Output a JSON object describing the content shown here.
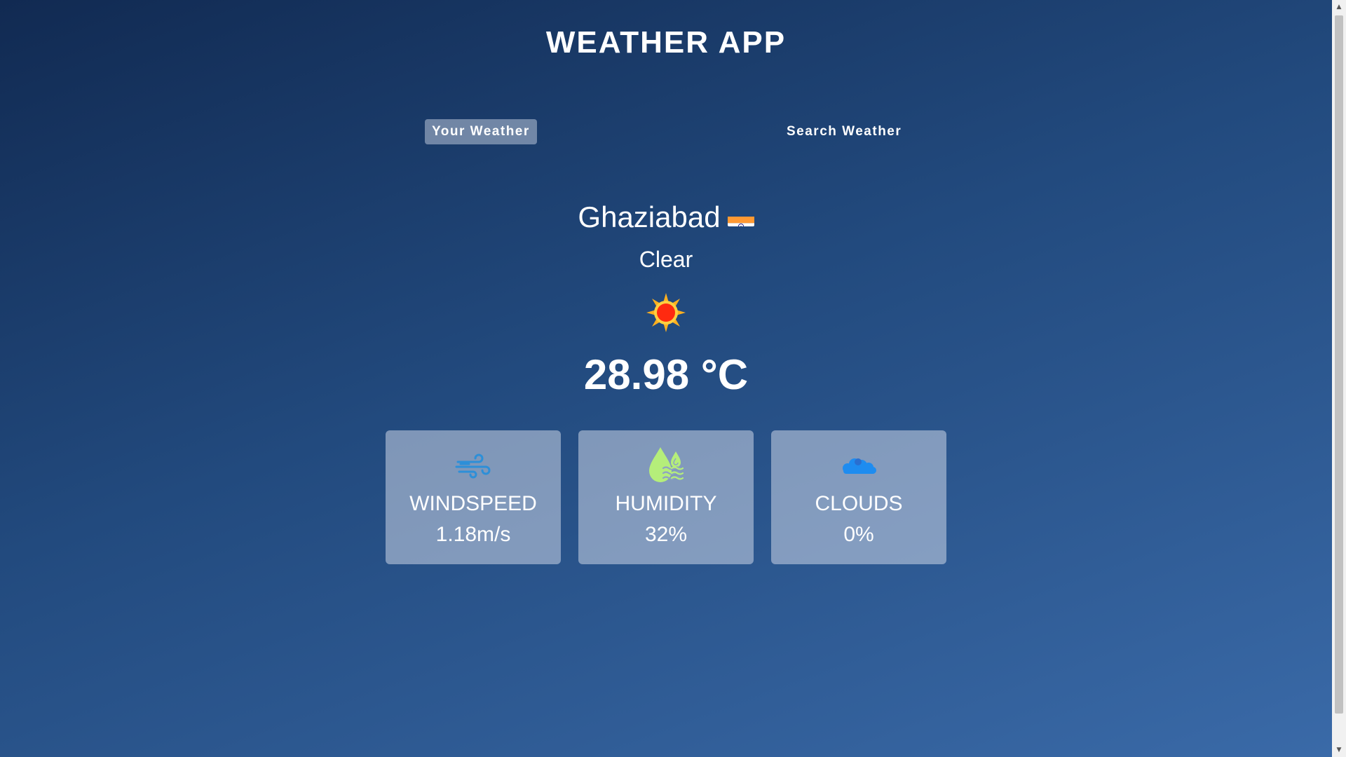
{
  "app": {
    "title": "WEATHER APP"
  },
  "tabs": [
    {
      "label": "Your Weather",
      "active": true
    },
    {
      "label": "Search Weather",
      "active": false
    }
  ],
  "weather": {
    "city": "Ghaziabad",
    "country_flag_icon": "india-flag-icon",
    "description": "Clear",
    "icon": "sun-icon",
    "temperature": "28.98 °C"
  },
  "cards": [
    {
      "label": "WINDSPEED",
      "value": "1.18m/s",
      "icon": "wind-icon"
    },
    {
      "label": "HUMIDITY",
      "value": "32%",
      "icon": "humidity-icon"
    },
    {
      "label": "CLOUDS",
      "value": "0%",
      "icon": "cloud-icon"
    }
  ],
  "colors": {
    "background_top": "#112a52",
    "background_bottom": "#3a6aa8",
    "card_background": "#8ea3c3",
    "wind_icon": "#2d8fd8",
    "humidity_icon": "#b5ee7a",
    "cloud_icon": "#1e8cf0",
    "sun_core": "#ff2a10",
    "sun_rays": "#ffb020"
  }
}
